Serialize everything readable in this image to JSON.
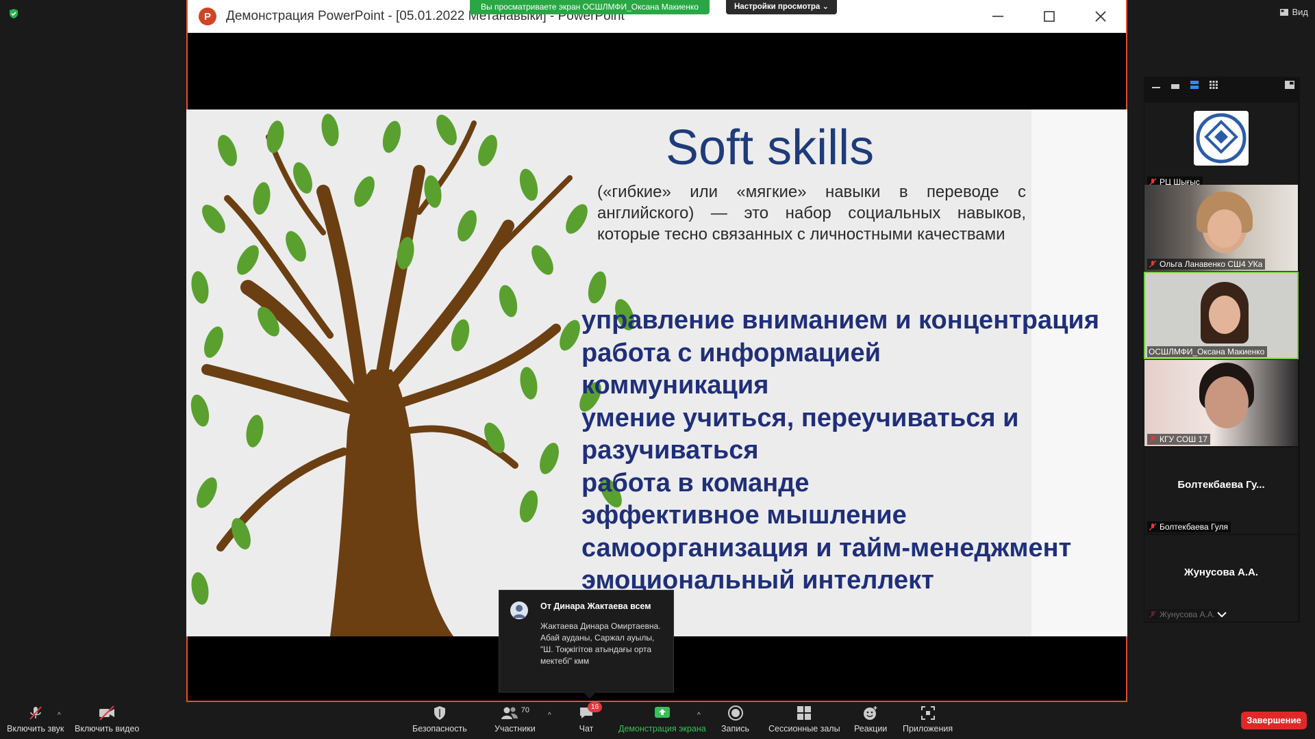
{
  "app": {
    "view_label": "Вид",
    "share_banner": "Вы просматриваете экран ОСШЛМФИ_Оксана Макиенко",
    "view_options": "Настройки просмотра ⌄"
  },
  "shared_window": {
    "title": "Демонстрация PowerPoint - [05.01.2022 Метанавыки] - PowerPoint",
    "logo_letter": "P"
  },
  "slide": {
    "title": "Soft skills",
    "definition": "(«гибкие» или «мягкие» навыки в переводе с английского) — это набор социальных навыков, которые тесно связанных с личностными качествами",
    "skills": [
      "управление вниманием и концентрация",
      "работа с информацией",
      "коммуникация",
      "умение учиться, переучиваться и",
      "разучиваться",
      "работа в команде",
      "эффективное мышление",
      "самоорганизация и тайм-менеджмент",
      "эмоциональный интеллект"
    ]
  },
  "participants": [
    {
      "name": "РЦ Шығыс",
      "center_label": ""
    },
    {
      "name": "Ольга Ланавенко СШ4 УКа",
      "center_label": ""
    },
    {
      "name": "ОСШЛМФИ_Оксана Макиенко",
      "center_label": ""
    },
    {
      "name": "КГУ СОШ 17",
      "center_label": ""
    },
    {
      "name": "Болтекбаева Гуля",
      "center_label": "Болтекбаева Гу..."
    },
    {
      "name": "Жунусова А.А.",
      "center_label": "Жунусова А.А."
    }
  ],
  "chat_popup": {
    "from": "От Динара Жактаева всем",
    "message": "Жактаева Динара Омиртаевна.  Абай ауданы, Саржал ауылы, \"Ш. Тоқжігітов атындағы орта мектебі\" кмм"
  },
  "toolbar": {
    "mute": "Включить звук",
    "video": "Включить видео",
    "security": "Безопасность",
    "participants": "Участники",
    "participants_count": "70",
    "chat": "Чат",
    "chat_badge": "16",
    "share": "Демонстрация экрана",
    "record": "Запись",
    "breakout": "Сессионные залы",
    "reactions": "Реакции",
    "apps": "Приложения",
    "end": "Завершение"
  },
  "colors": {
    "share_green": "#29a745",
    "end_red": "#e02828",
    "slide_title": "#1e3b7a",
    "skills_text": "#1f2f7a"
  }
}
